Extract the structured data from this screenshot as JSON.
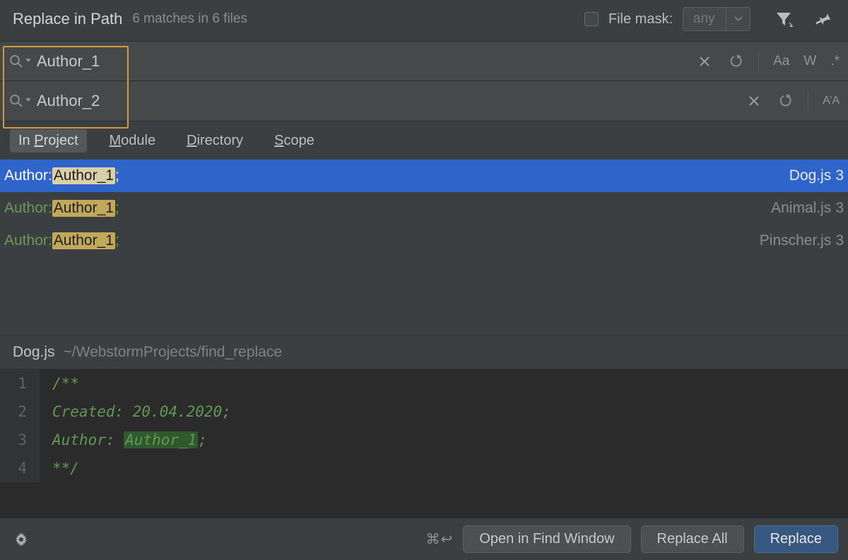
{
  "header": {
    "title": "Replace in Path",
    "subtitle": "6 matches in 6 files",
    "file_mask_label": "File mask:",
    "file_mask_value": "any"
  },
  "search": {
    "find_value": "Author_1",
    "replace_value": "Author_2"
  },
  "toggles": {
    "case": "Aa",
    "word": "W",
    "regex": ".*",
    "preserve_case": "A’A"
  },
  "scope_tabs": [
    {
      "label_pre": "In ",
      "ul": "P",
      "label_post": "roject",
      "active": true
    },
    {
      "label_pre": "",
      "ul": "M",
      "label_post": "odule",
      "active": false
    },
    {
      "label_pre": "",
      "ul": "D",
      "label_post": "irectory",
      "active": false
    },
    {
      "label_pre": "",
      "ul": "S",
      "label_post": "cope",
      "active": false
    }
  ],
  "results": [
    {
      "label": "Author: ",
      "match": "Author_1",
      "semi": ";",
      "file": "Dog.js",
      "line": "3",
      "selected": true
    },
    {
      "label": "Author: ",
      "match": "Author_1",
      "semi": ";",
      "file": "Animal.js",
      "line": "3",
      "selected": false
    },
    {
      "label": "Author: ",
      "match": "Author_1",
      "semi": ";",
      "file": "Pinscher.js",
      "line": "3",
      "selected": false
    }
  ],
  "preview": {
    "file": "Dog.js",
    "path": "~/WebstormProjects/find_replace",
    "lines": [
      {
        "n": "1",
        "text": "/**"
      },
      {
        "n": "2",
        "text": " Created: 20.04.2020;"
      },
      {
        "n": "3",
        "text_pre": " Author: ",
        "hl": "Author_1",
        "text_post": ";"
      },
      {
        "n": "4",
        "text": " **/"
      }
    ]
  },
  "footer": {
    "shortcut": "⌘↩",
    "open_btn": "Open in Find Window",
    "replace_all_btn": "Replace All",
    "replace_btn": "Replace"
  }
}
